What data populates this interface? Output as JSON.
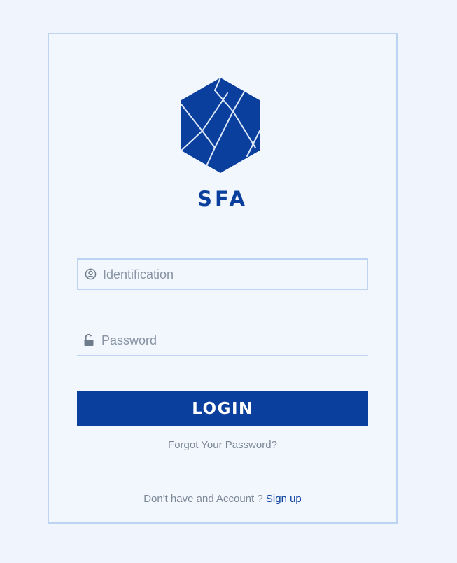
{
  "brand": {
    "name": "SFA",
    "color": "#0b3f9e"
  },
  "form": {
    "identification": {
      "placeholder": "Identification",
      "value": "",
      "icon": "user-circle-icon"
    },
    "password": {
      "placeholder": "Password",
      "value": "",
      "icon": "unlock-icon"
    },
    "login_label": "LOGIN",
    "forgot_label": "Forgot Your Password?"
  },
  "footer": {
    "prompt": "Don't have and Account ?",
    "signup_label": "Sign up"
  },
  "colors": {
    "background": "#f0f5fd",
    "border": "#bcd3f2",
    "accent": "#0b3f9e",
    "muted_text": "#7c8796"
  }
}
